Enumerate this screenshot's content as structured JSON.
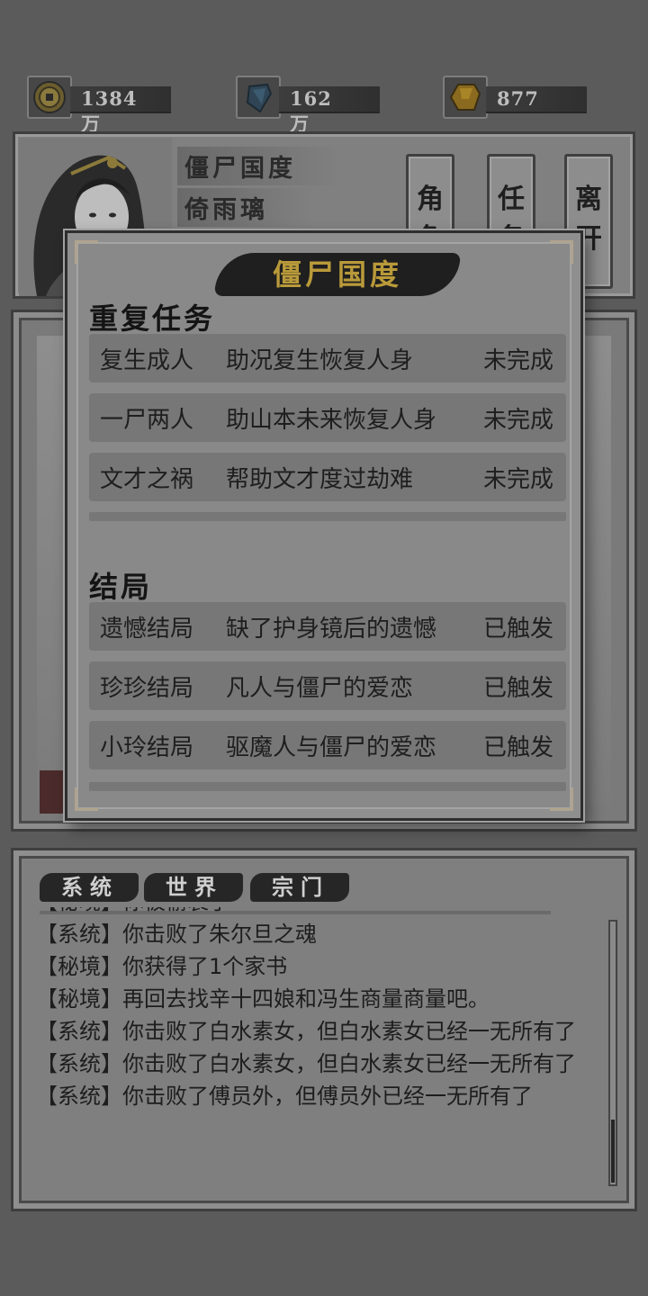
{
  "currencies": [
    {
      "icon": "coin-icon",
      "value": "1384万"
    },
    {
      "icon": "crystal-icon",
      "value": "162万"
    },
    {
      "icon": "gem-icon",
      "value": "877"
    }
  ],
  "header": {
    "line1": "僵尸国度",
    "line2": "倚雨璃",
    "buttons": [
      {
        "label": "角色",
        "visible_chars": [
          "角",
          "色"
        ]
      },
      {
        "label": "任务",
        "visible_chars": [
          "任",
          "务"
        ]
      },
      {
        "label": "离开",
        "visible_chars": [
          "离",
          "开"
        ]
      }
    ]
  },
  "modal": {
    "title": "僵尸国度",
    "repeat_section_title": "重复任务",
    "repeat_tasks": [
      {
        "name": "复生成人",
        "desc": "助况复生恢复人身",
        "status": "未完成"
      },
      {
        "name": "一尸两人",
        "desc": "助山本未来恢复人身",
        "status": "未完成"
      },
      {
        "name": "文才之祸",
        "desc": "帮助文才度过劫难",
        "status": "未完成"
      }
    ],
    "ending_section_title": "结局",
    "endings": [
      {
        "name": "遗憾结局",
        "desc": "缺了护身镜后的遗憾",
        "status": "已触发"
      },
      {
        "name": "珍珍结局",
        "desc": "凡人与僵尸的爱恋",
        "status": "已触发"
      },
      {
        "name": "小玲结局",
        "desc": "驱魔人与僵尸的爱恋",
        "status": "已触发"
      }
    ]
  },
  "chat": {
    "tabs": [
      "系统",
      "世界",
      "宗门"
    ],
    "lines": [
      "【秘境】你被偷袭了",
      "【系统】你击败了朱尔旦之魂",
      "【秘境】你获得了1个家书",
      "【秘境】再回去找辛十四娘和冯生商量商量吧。",
      "【系统】你击败了白水素女，但白水素女已经一无所有了",
      "【系统】你击败了白水素女，但白水素女已经一无所有了",
      "【系统】你击败了傅员外，但傅员外已经一无所有了"
    ]
  },
  "colors": {
    "overlay": "#5b5b5b",
    "title_gold": "#b99a3a"
  }
}
